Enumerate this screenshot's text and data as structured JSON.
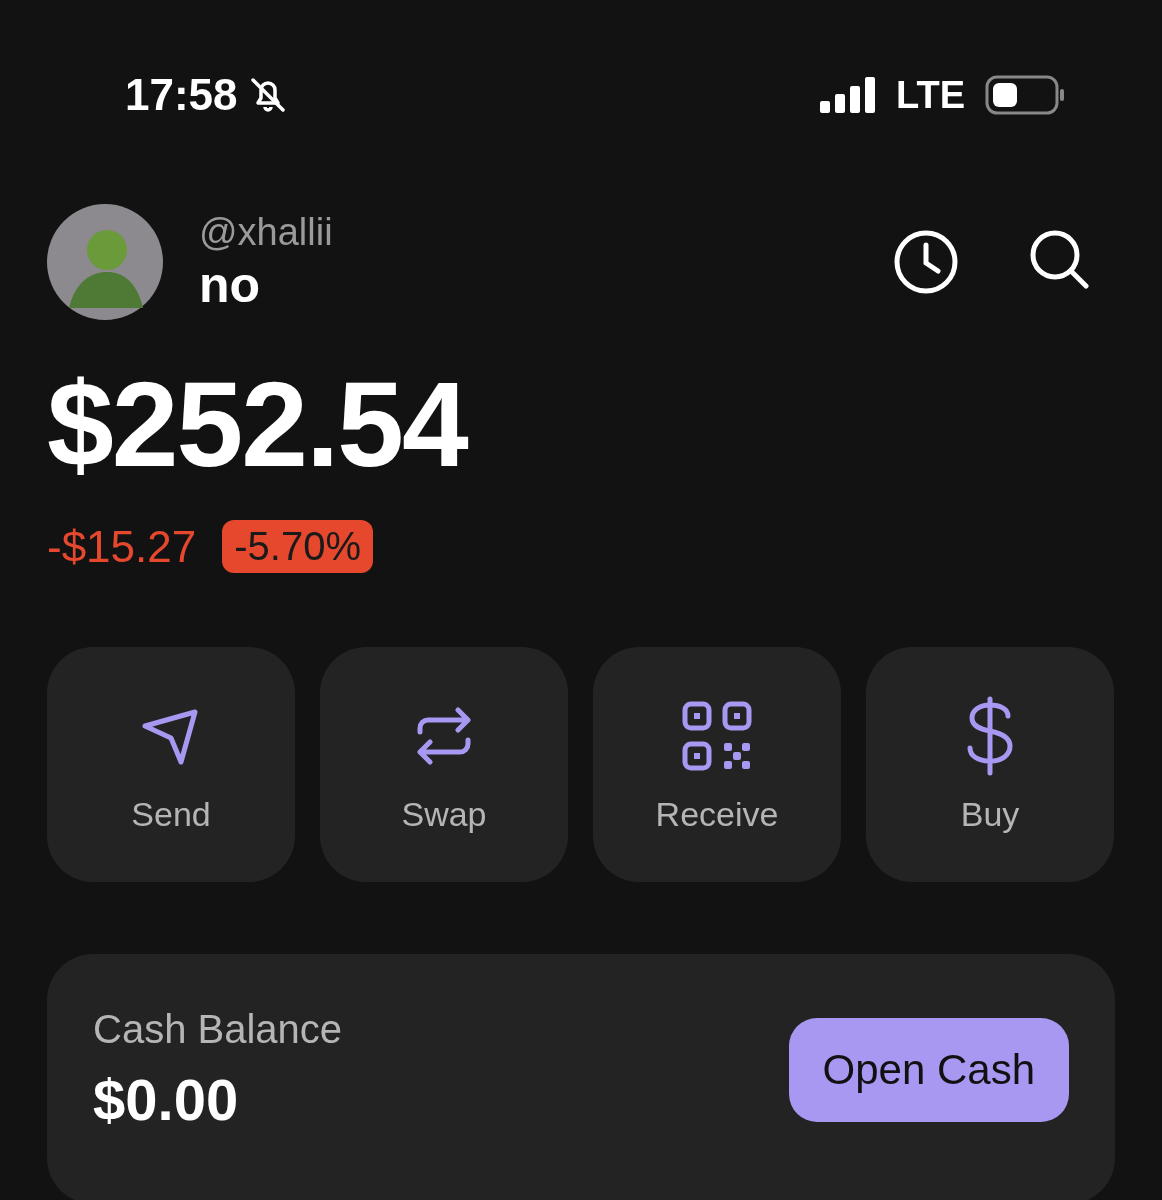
{
  "status_bar": {
    "time": "17:58",
    "silent": true,
    "network": "LTE"
  },
  "profile": {
    "handle": "@xhallii",
    "name": "no"
  },
  "balance": {
    "amount": "$252.54",
    "change": "-$15.27",
    "change_percent": "-5.70%",
    "negative": true
  },
  "actions": [
    {
      "kind": "send",
      "label": "Send"
    },
    {
      "kind": "swap",
      "label": "Swap"
    },
    {
      "kind": "receive",
      "label": "Receive"
    },
    {
      "kind": "buy",
      "label": "Buy"
    }
  ],
  "cash": {
    "label": "Cash Balance",
    "amount": "$0.00",
    "button": "Open Cash"
  }
}
